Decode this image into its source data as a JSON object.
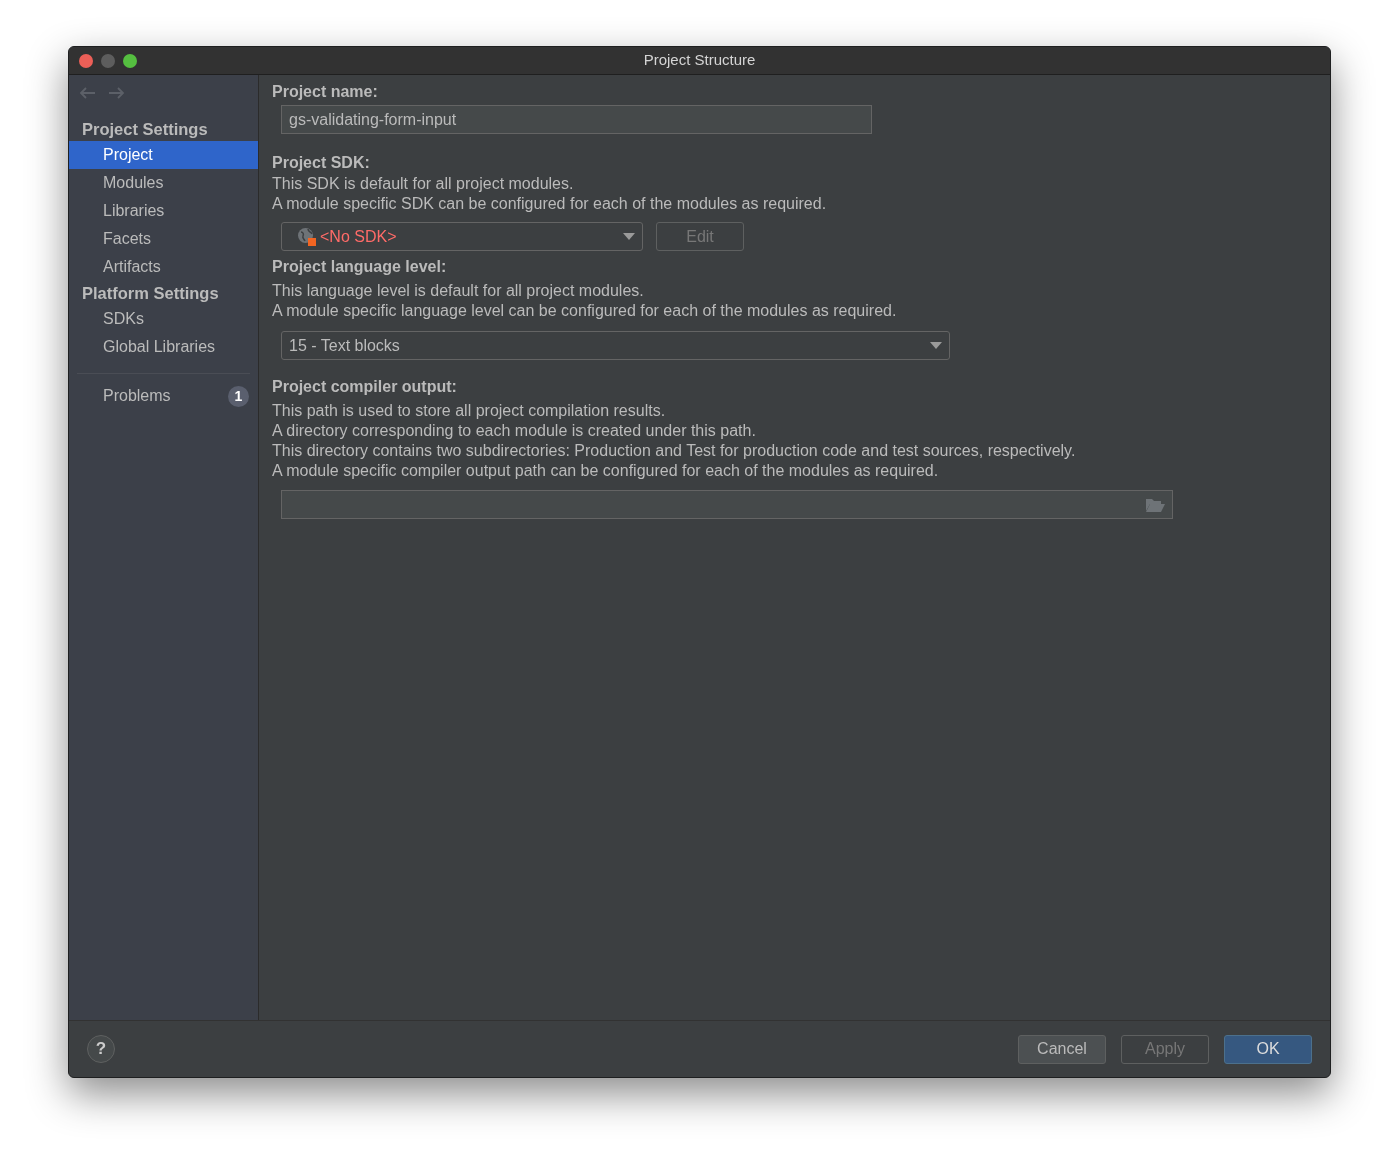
{
  "window": {
    "title": "Project Structure"
  },
  "sidebar": {
    "groups": [
      {
        "heading": "Project Settings",
        "items": [
          {
            "label": "Project",
            "selected": true
          },
          {
            "label": "Modules",
            "selected": false
          },
          {
            "label": "Libraries",
            "selected": false
          },
          {
            "label": "Facets",
            "selected": false
          },
          {
            "label": "Artifacts",
            "selected": false
          }
        ]
      },
      {
        "heading": "Platform Settings",
        "items": [
          {
            "label": "SDKs",
            "selected": false
          },
          {
            "label": "Global Libraries",
            "selected": false
          }
        ]
      }
    ],
    "problems": {
      "label": "Problems",
      "count": "1",
      "selected": false
    }
  },
  "sections": [
    {
      "kind": "text",
      "heading": "Project name:",
      "value": "gs-validating-form-input"
    },
    {
      "kind": "sdk",
      "heading": "Project SDK:",
      "lines": [
        "This SDK is default for all project modules.",
        "A module specific SDK can be configured for each of the modules as required."
      ],
      "value": "<No SDK>",
      "button": {
        "label": "Edit",
        "disabled": true
      }
    },
    {
      "kind": "combo",
      "heading": "Project language level:",
      "lines": [
        "This language level is default for all project modules.",
        "A module specific language level can be configured for each of the modules as required."
      ],
      "value": "15 - Text blocks"
    },
    {
      "kind": "path",
      "heading": "Project compiler output:",
      "lines": [
        "This path is used to store all project compilation results.",
        "A directory corresponding to each module is created under this path.",
        "This directory contains two subdirectories: Production and Test for production code and test sources, respectively.",
        "A module specific compiler output path can be configured for each of the modules as required."
      ]
    }
  ],
  "footer": {
    "help": "?",
    "buttons": [
      {
        "label": "Cancel",
        "disabled": false,
        "default": false
      },
      {
        "label": "Apply",
        "disabled": true,
        "default": false
      },
      {
        "label": "OK",
        "disabled": false,
        "default": true
      }
    ]
  }
}
